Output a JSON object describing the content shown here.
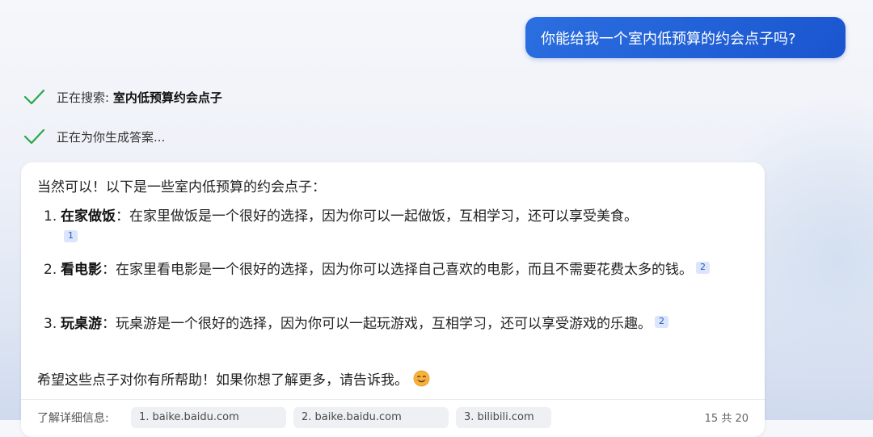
{
  "user_message": "你能给我一个室内低预算的约会点子吗?",
  "status": {
    "searching_label": "正在搜索: ",
    "searching_query": "室内低预算约会点子",
    "generating_label": "正在为你生成答案..."
  },
  "answer": {
    "intro": "当然可以！以下是一些室内低预算的约会点子：",
    "items": [
      {
        "number": "1.",
        "title": "在家做饭",
        "text": "：在家里做饭是一个很好的选择，因为你可以一起做饭，互相学习，还可以享受美食。",
        "citation": "1"
      },
      {
        "number": "2.",
        "title": "看电影",
        "text": "：在家里看电影是一个很好的选择，因为你可以选择自己喜欢的电影，而且不需要花费太多的钱。",
        "citation": "2"
      },
      {
        "number": "3.",
        "title": "玩桌游",
        "text": "：玩桌游是一个很好的选择，因为你可以一起玩游戏，互相学习，还可以享受游戏的乐趣。",
        "citation": "2"
      }
    ],
    "closing": "希望这些点子对你有所帮助！如果你想了解更多，请告诉我。",
    "emoji": "smiling-face-emoji"
  },
  "footer": {
    "learn_more": "了解详细信息:",
    "chips": [
      "1. baike.baidu.com",
      "2. baike.baidu.com",
      "3. bilibili.com"
    ],
    "counter": "15 共 20"
  },
  "colors": {
    "user_bubble": "#1a55cf",
    "check": "#2aa848",
    "citation_bg": "#dbe5fb",
    "citation_text": "#2657c9"
  }
}
